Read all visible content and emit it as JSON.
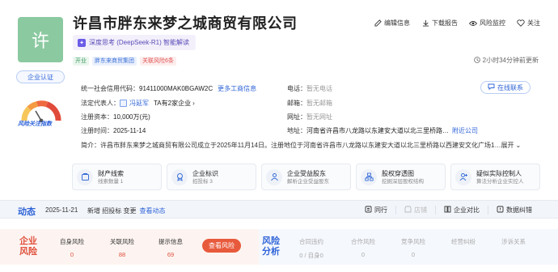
{
  "company": {
    "logo_char": "许",
    "name": "许昌市胖东来梦之城商贸有限公司",
    "ai_chip": "深度思考 (DeepSeek-R1) 智能解读",
    "tags": [
      "开业",
      "胖东来商贸集团",
      "关联风险6条"
    ],
    "updated": "2小时34分钟前更新"
  },
  "actions": [
    {
      "label": "编辑信息",
      "icon": "edit-icon"
    },
    {
      "label": "下载报告",
      "icon": "download-icon"
    },
    {
      "label": "风险监控",
      "icon": "eye-icon"
    },
    {
      "label": "关注",
      "icon": "heart-icon"
    }
  ],
  "left": {
    "cert": "企业认证",
    "gauge_label": "风险关注指数"
  },
  "info": {
    "credit_code_label": "统一社会信用代码：",
    "credit_code": "91411000MAK0BGAW2C",
    "more_link": "更多工商信息",
    "phone_label": "电话：",
    "phone": "暂无电话",
    "legal_label": "法定代表人：",
    "legal": "冯延军",
    "legal_extra": "TA有2家企业",
    "email_label": "邮箱：",
    "email": "暂无邮箱",
    "capital_label": "注册资本：",
    "capital": "10,000万(元)",
    "website_label": "网址：",
    "website": "暂无网址",
    "date_label": "注册时间：",
    "date": "2025-11-14",
    "address_label": "地址：",
    "address": "河南省许昌市八龙路以东建安大道以北三里桥路…",
    "nearby": "附近公司",
    "online": "在线联系",
    "brief_label": "简介：",
    "brief": "许昌市胖东来梦之城商贸有限公司成立于2025年11月14日。注册地位于河南省许昌市八龙路以东建安大道以北三里桥路以西建安文化广场1…",
    "brief_more": "展开"
  },
  "cards": [
    {
      "title": "财产线索",
      "sub": "线索数量 1",
      "icon": "property-icon"
    },
    {
      "title": "企业标识",
      "sub": "招投标 3",
      "icon": "badge-icon"
    },
    {
      "title": "企业受益股东",
      "sub": "解析企业受益股东",
      "icon": "shareholder-icon"
    },
    {
      "title": "股权穿透图",
      "sub": "挖掘深层股权结构",
      "icon": "equity-chart-icon"
    },
    {
      "title": "疑似实际控制人",
      "sub": "算法分析企业实控人",
      "icon": "controller-icon"
    }
  ],
  "dynamics": {
    "title": "动态",
    "date": "2025-11-21",
    "text": "新增 招投标 变更",
    "link": "查看动态",
    "tools": [
      {
        "label": "同行",
        "icon": "peer-icon",
        "disabled": false
      },
      {
        "label": "店铺",
        "icon": "shop-icon",
        "disabled": true
      },
      {
        "label": "企业对比",
        "icon": "compare-icon",
        "disabled": false
      },
      {
        "label": "数据纠错",
        "icon": "correct-icon",
        "disabled": false
      }
    ]
  },
  "risk": {
    "left_title": "企业风险",
    "left_cols": [
      {
        "label": "自身风险",
        "value": "0"
      },
      {
        "label": "关联风险",
        "value": "88"
      },
      {
        "label": "提示信息",
        "value": "69"
      }
    ],
    "check_btn": "查看风险",
    "right_title": "风险分析",
    "right_cols": [
      {
        "label": "合同违约",
        "value": "0 / 自身0"
      },
      {
        "label": "合作风险",
        "value": "0"
      },
      {
        "label": "竞争风险",
        "value": "0"
      },
      {
        "label": "经营纠纷",
        "value": ""
      },
      {
        "label": "涉诉关系",
        "value": ""
      }
    ]
  },
  "colors": {
    "brand_blue": "#2f64d8",
    "logo_green": "#8bc9a0",
    "risk_red": "#e85a3c"
  }
}
